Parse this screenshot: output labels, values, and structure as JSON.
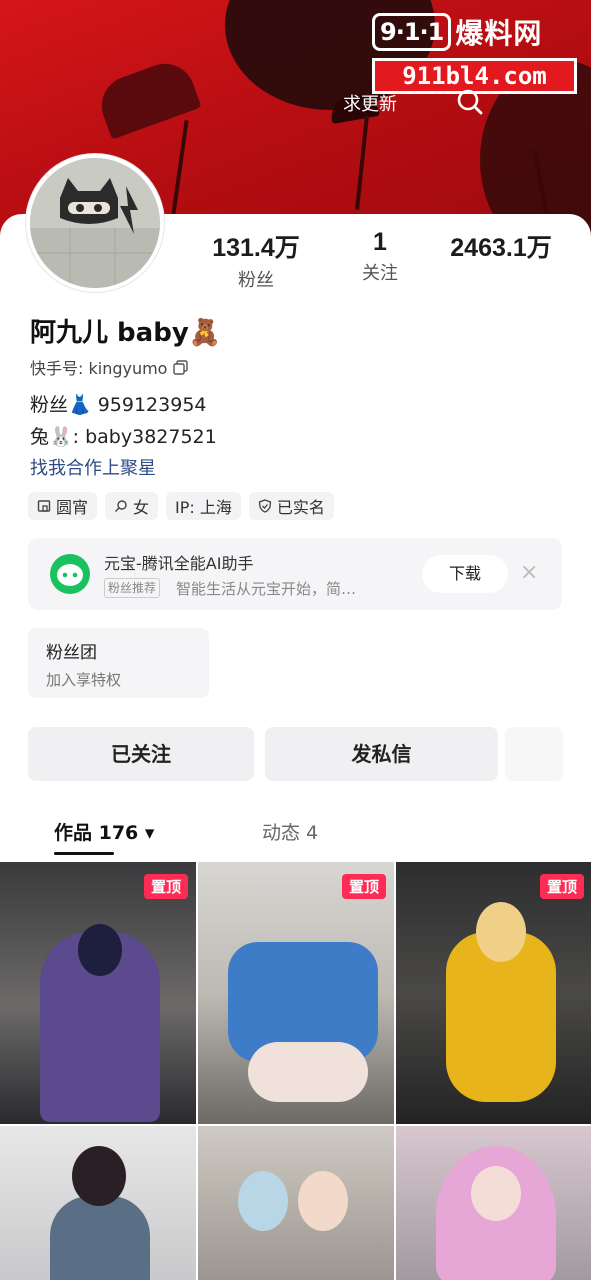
{
  "watermark": {
    "logo": "9·1·1",
    "name": "爆料网",
    "url": "911bl4.com"
  },
  "header": {
    "update_label": "求更新"
  },
  "profile": {
    "name": "阿九儿 baby🧸",
    "kuaishou_id_label": "快手号: kingyumo",
    "bio_line1": "粉丝👗 959123954",
    "bio_line2": "兔🐰: baby3827521",
    "link_text": "找我合作上聚星"
  },
  "stats": [
    {
      "value": "131.4万",
      "label": "粉丝"
    },
    {
      "value": "1",
      "label": "关注"
    },
    {
      "value": "2463.1万",
      "label": ""
    }
  ],
  "tags": [
    {
      "icon": "home-icon",
      "label": "圆宵"
    },
    {
      "icon": "female-icon",
      "label": "女"
    },
    {
      "icon": "",
      "label": "IP: 上海"
    },
    {
      "icon": "shield-check-icon",
      "label": "已实名"
    }
  ],
  "ad": {
    "title": "元宝-腾讯全能AI助手",
    "badge": "粉丝推荐",
    "description": "智能生活从元宝开始，简…",
    "download_label": "下载",
    "close_label": "×",
    "accent": "#19c15f"
  },
  "fanclub": {
    "title": "粉丝团",
    "subtitle": "加入享特权"
  },
  "actions": {
    "followed_label": "已关注",
    "dm_label": "发私信",
    "more_label": ""
  },
  "tabs": [
    {
      "label": "作品 176 ▾"
    },
    {
      "label": "动态 4"
    },
    {
      "label": ""
    }
  ],
  "grid": {
    "pinned_label": "置顶"
  },
  "colors": {
    "banner": "#c4121a",
    "pinned": "#fe2c55",
    "link": "#2d4d84"
  }
}
